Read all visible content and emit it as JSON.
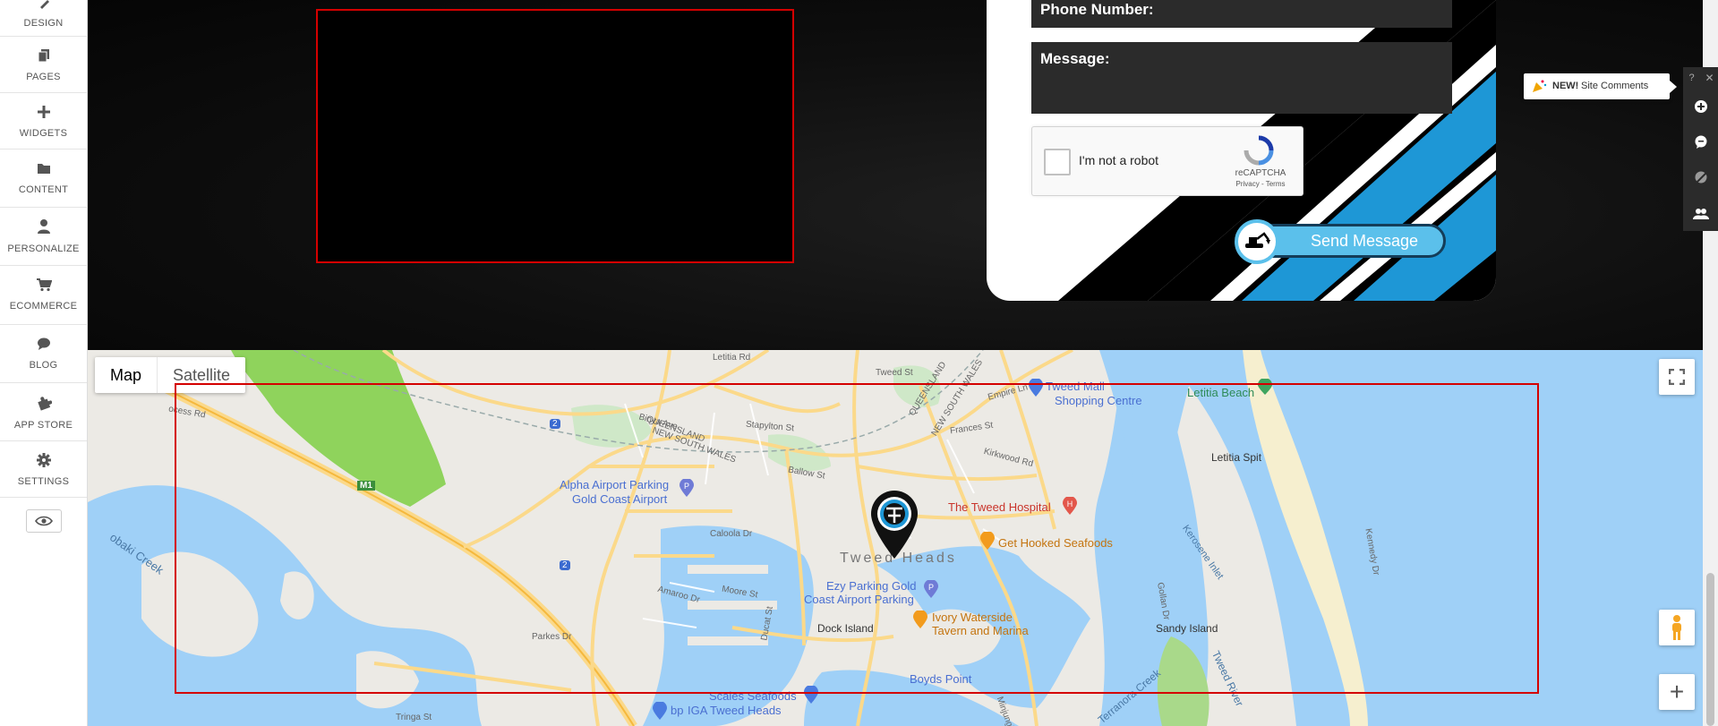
{
  "sidebar": {
    "items": [
      {
        "label": "DESIGN",
        "icon": "brush-icon"
      },
      {
        "label": "PAGES",
        "icon": "pages-icon"
      },
      {
        "label": "WIDGETS",
        "icon": "plus-icon"
      },
      {
        "label": "CONTENT",
        "icon": "folder-icon"
      },
      {
        "label": "PERSONALIZE",
        "icon": "user-icon"
      },
      {
        "label": "ECOMMERCE",
        "icon": "cart-icon"
      },
      {
        "label": "BLOG",
        "icon": "chat-bubble-icon"
      },
      {
        "label": "APP STORE",
        "icon": "puzzle-icon"
      },
      {
        "label": "SETTINGS",
        "icon": "gear-icon"
      }
    ],
    "preview_icon": "eye-icon"
  },
  "contact_form": {
    "phone_label": "Phone Number:",
    "message_label": "Message:",
    "recaptcha": {
      "label": "I'm not a robot",
      "brand": "reCAPTCHA",
      "links": "Privacy - Terms"
    },
    "send_button": "Send Message",
    "send_icon": "excavator-icon"
  },
  "editor_tools": {
    "help": "?",
    "close": "✕",
    "site_comments": {
      "badge": "NEW!",
      "text": "Site Comments"
    }
  },
  "map": {
    "type_tabs": {
      "map": "Map",
      "satellite": "Satellite"
    },
    "labels": {
      "tweed_mall": "Tweed Mall",
      "shopping_centre": "Shopping Centre",
      "letitia_beach": "Letitia Beach",
      "letitia_spit": "Letitia Spit",
      "alpha_parking": "Alpha Airport Parking",
      "gold_coast_airport": "Gold Coast Airport",
      "tweed_hospital": "The Tweed Hospital",
      "get_hooked": "Get Hooked Seafoods",
      "tweed_heads": "Tweed Heads",
      "ezy_parking": "Ezy Parking Gold",
      "coast_airport_parking": "Coast Airport Parking",
      "ivory_waterside": "Ivory Waterside",
      "tavern_marina": "Tavern and Marina",
      "dock_island": "Dock Island",
      "sandy_island": "Sandy Island",
      "boyds_point": "Boyds Point",
      "scales_seafoods": "Scales Seafoods",
      "iga_tweed_heads": "IGA Tweed Heads",
      "bp": "bp",
      "queensland": "QUEENSLAND",
      "new_south_wales": "NEW SOUTH WALES",
      "queensland_2": "QUEENSLAND",
      "new_south_wales_2": "NEW SOUTH WALES",
      "m1": "M1",
      "route_2a": "2",
      "route_2b": "2",
      "kirra_creek": "obaki Creek",
      "terranora_creek": "Terranora Creek",
      "tweed_river": "Tweed River",
      "kerosene_inlet": "Kerosene Inlet",
      "stapylton_st": "Stapylton St",
      "frances_st": "Frances St",
      "ballow_st": "Ballow St",
      "caloola_dr": "Caloola Dr",
      "ducat_st": "Ducat St",
      "parkes_dr": "Parkes Dr",
      "tringa_st": "Tringa St",
      "minjungbal": "Minjungbal",
      "letitia_rd": "Letitia Rd",
      "kennedy_dr": "Kennedy Dr",
      "gollan_dr": "Gollan Dr",
      "tweed_st": "Tweed St",
      "binya_ave": "Binya Ave",
      "kirkwood_rd": "Kirkwood Rd",
      "empire_ln": "Empire Ln",
      "ocess_rd": "ocess Rd",
      "moore_st": "Moore St",
      "amaroo_dr": "Amaroo Dr"
    },
    "controls": {
      "fullscreen_icon": "fullscreen-icon",
      "pegman_icon": "pegman-icon",
      "zoom_in": "+"
    }
  }
}
